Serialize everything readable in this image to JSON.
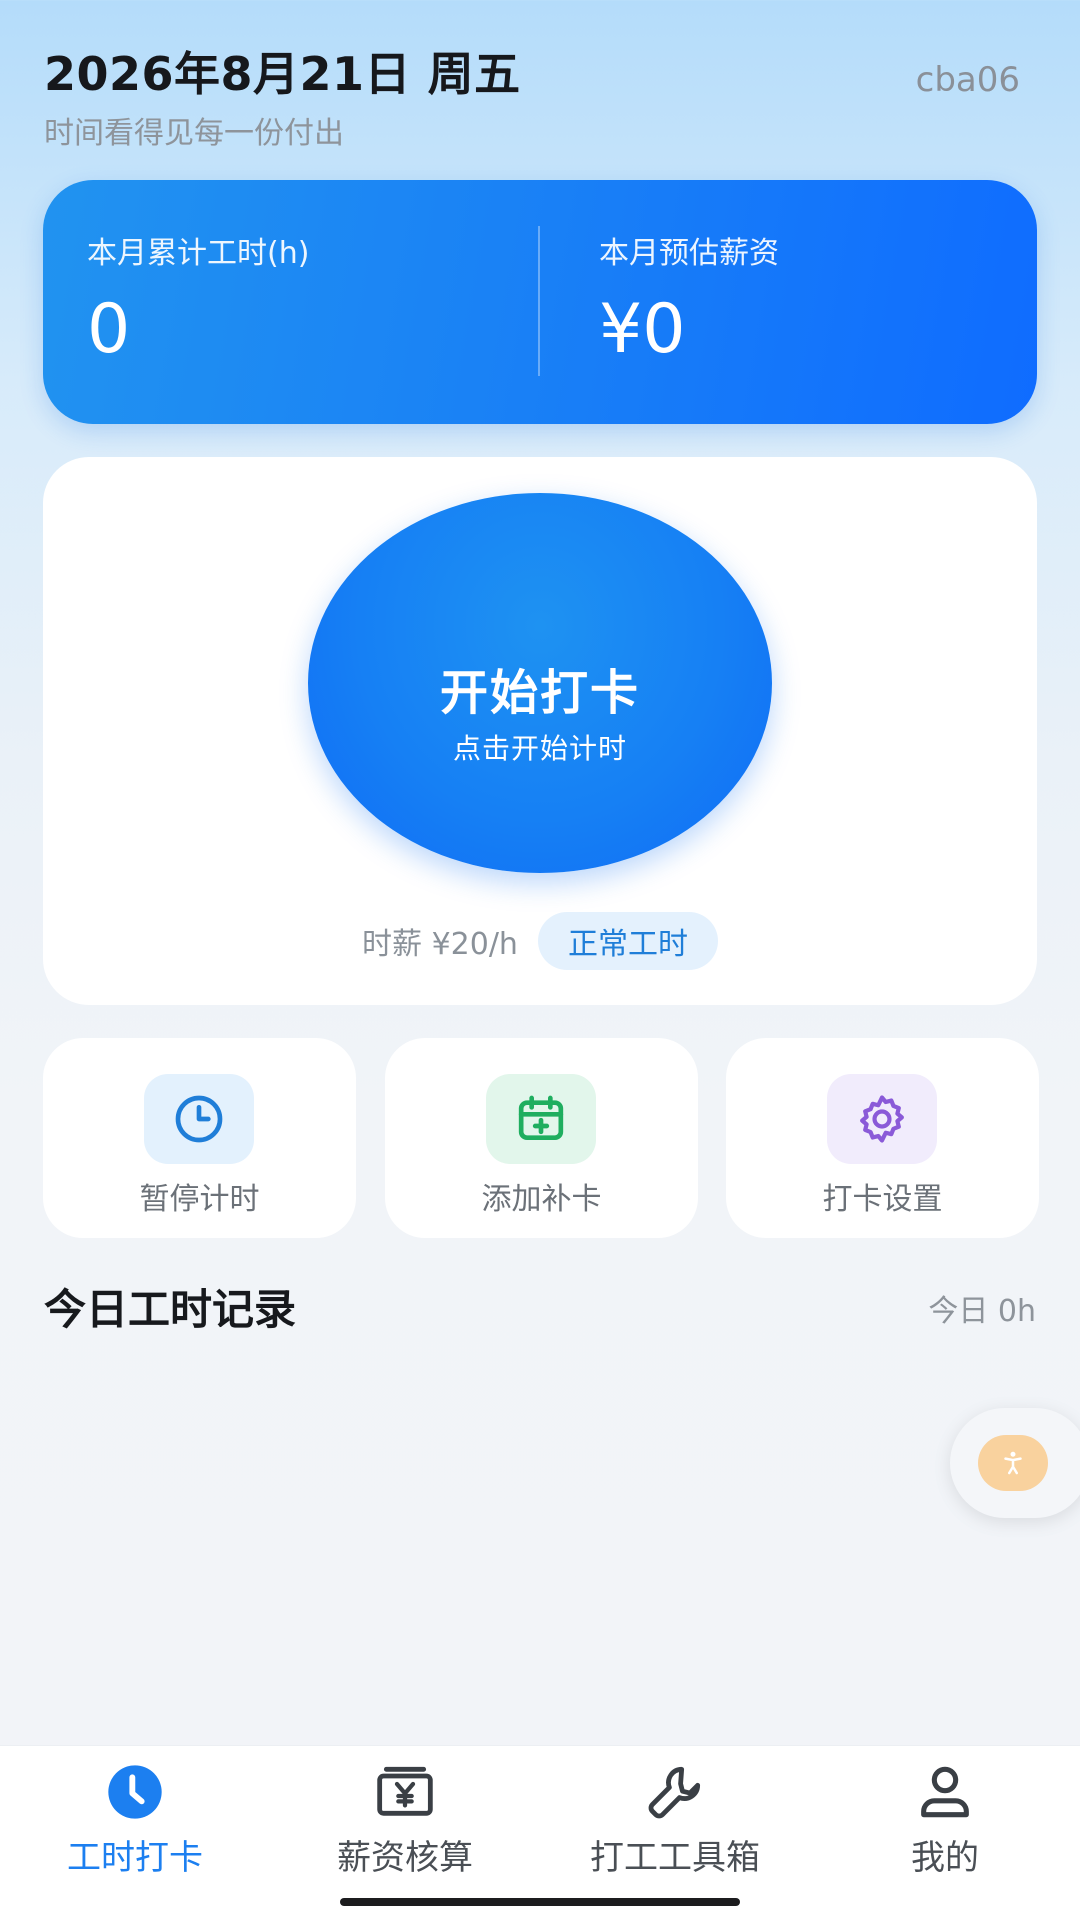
{
  "header": {
    "date": "2026年8月21日 周五",
    "subtitle": "时间看得见每一份付出",
    "username": "cba06"
  },
  "summary": {
    "hours_label": "本月累计工时(h)",
    "hours_value": "0",
    "salary_label": "本月预估薪资",
    "salary_value": "¥0"
  },
  "punch": {
    "title": "开始打卡",
    "subtitle": "点击开始计时",
    "rate": "时薪 ¥20/h",
    "mode": "正常工时"
  },
  "actions": [
    {
      "label": "暂停计时",
      "icon": "clock-icon",
      "color": "#1f7ed8"
    },
    {
      "label": "添加补卡",
      "icon": "calendar-add-icon",
      "color": "#1fae5f"
    },
    {
      "label": "打卡设置",
      "icon": "gear-icon",
      "color": "#8a5ad8"
    }
  ],
  "records": {
    "title": "今日工时记录",
    "total": "今日 0h"
  },
  "nav": [
    {
      "label": "工时打卡",
      "icon": "clock-icon",
      "active": true
    },
    {
      "label": "薪资核算",
      "icon": "yen-wallet-icon",
      "active": false
    },
    {
      "label": "打工工具箱",
      "icon": "wrench-icon",
      "active": false
    },
    {
      "label": "我的",
      "icon": "user-icon",
      "active": false
    }
  ],
  "colors": {
    "accent": "#1c7ff0",
    "card_gradient_start": "#2193f0",
    "card_gradient_end": "#0f6cff"
  }
}
